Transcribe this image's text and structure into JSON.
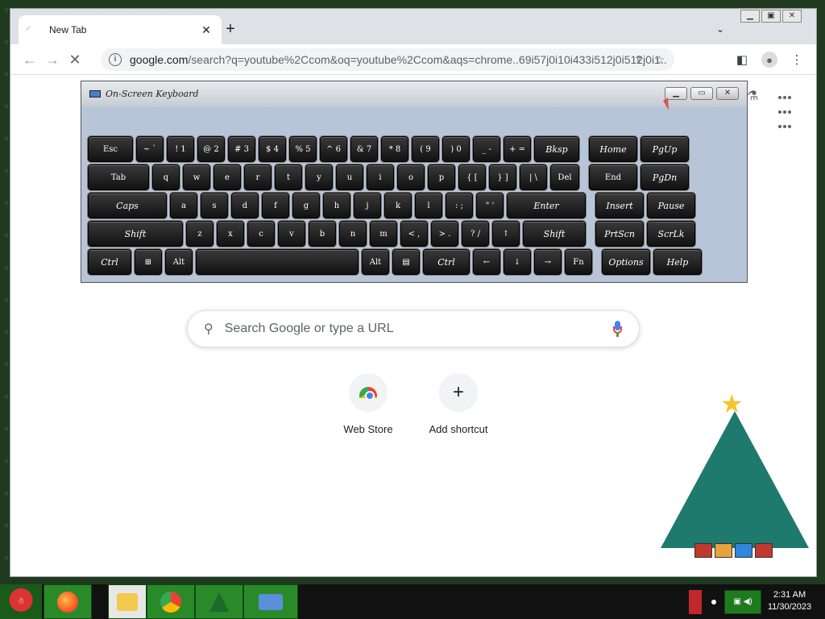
{
  "browser": {
    "tab": {
      "title": "New Tab"
    },
    "address": {
      "host": "google.com",
      "path": "/search?q=youtube%2Ccom&oq=youtube%2Ccom&aqs=chrome..69i57j0i10i433i512j0i512j0i1..."
    }
  },
  "page": {
    "search_placeholder": "Search Google or type a URL",
    "shortcuts": [
      {
        "label": "Web Store"
      },
      {
        "label": "Add shortcut"
      }
    ]
  },
  "osk": {
    "title": "On-Screen Keyboard",
    "rows": [
      [
        {
          "label": "Esc",
          "w": 60
        },
        {
          "label": "~ `",
          "w": 38
        },
        {
          "label": "! 1",
          "w": 38
        },
        {
          "label": "@ 2",
          "w": 38
        },
        {
          "label": "# 3",
          "w": 38
        },
        {
          "label": "$ 4",
          "w": 38
        },
        {
          "label": "% 5",
          "w": 38
        },
        {
          "label": "^ 6",
          "w": 38
        },
        {
          "label": "& 7",
          "w": 38
        },
        {
          "label": "* 8",
          "w": 38
        },
        {
          "label": "( 9",
          "w": 38
        },
        {
          "label": ") 0",
          "w": 38
        },
        {
          "label": "_ -",
          "w": 38
        },
        {
          "label": "+ =",
          "w": 38
        },
        {
          "label": "Bksp",
          "w": 60
        },
        {
          "label": "Home",
          "w": 64,
          "gap": 8
        },
        {
          "label": "PgUp",
          "w": 64
        }
      ],
      [
        {
          "label": "Tab",
          "w": 80
        },
        {
          "label": "q",
          "w": 38
        },
        {
          "label": "w",
          "w": 38
        },
        {
          "label": "e",
          "w": 38
        },
        {
          "label": "r",
          "w": 38
        },
        {
          "label": "t",
          "w": 38
        },
        {
          "label": "y",
          "w": 38
        },
        {
          "label": "u",
          "w": 38
        },
        {
          "label": "i",
          "w": 38
        },
        {
          "label": "o",
          "w": 38
        },
        {
          "label": "p",
          "w": 38
        },
        {
          "label": "{ [",
          "w": 38
        },
        {
          "label": "} ]",
          "w": 38
        },
        {
          "label": "| \\",
          "w": 38
        },
        {
          "label": "Del",
          "w": 40
        },
        {
          "label": "End",
          "w": 64,
          "gap": 8
        },
        {
          "label": "PgDn",
          "w": 64
        }
      ],
      [
        {
          "label": "Caps",
          "w": 102
        },
        {
          "label": "a",
          "w": 38
        },
        {
          "label": "s",
          "w": 38
        },
        {
          "label": "d",
          "w": 38
        },
        {
          "label": "f",
          "w": 38
        },
        {
          "label": "g",
          "w": 38
        },
        {
          "label": "h",
          "w": 38
        },
        {
          "label": "j",
          "w": 38
        },
        {
          "label": "k",
          "w": 38
        },
        {
          "label": "l",
          "w": 38
        },
        {
          "label": ": ;",
          "w": 38
        },
        {
          "label": "\" '",
          "w": 38
        },
        {
          "label": "Enter",
          "w": 102
        },
        {
          "label": "Insert",
          "w": 64,
          "gap": 8
        },
        {
          "label": "Pause",
          "w": 64
        }
      ],
      [
        {
          "label": "Shift",
          "w": 122
        },
        {
          "label": "z",
          "w": 38
        },
        {
          "label": "x",
          "w": 38
        },
        {
          "label": "c",
          "w": 38
        },
        {
          "label": "v",
          "w": 38
        },
        {
          "label": "b",
          "w": 38
        },
        {
          "label": "n",
          "w": 38
        },
        {
          "label": "m",
          "w": 38
        },
        {
          "label": "< ,",
          "w": 38
        },
        {
          "label": "> .",
          "w": 38
        },
        {
          "label": "? /",
          "w": 38
        },
        {
          "label": "↑",
          "w": 38
        },
        {
          "label": "Shift",
          "w": 82
        },
        {
          "label": "PrtScn",
          "w": 64,
          "gap": 8
        },
        {
          "label": "ScrLk",
          "w": 64
        }
      ],
      [
        {
          "label": "Ctrl",
          "w": 58
        },
        {
          "label": "⊞",
          "w": 38
        },
        {
          "label": "Alt",
          "w": 38
        },
        {
          "label": "",
          "w": 206
        },
        {
          "label": "Alt",
          "w": 38
        },
        {
          "label": "▤",
          "w": 38
        },
        {
          "label": "Ctrl",
          "w": 62
        },
        {
          "label": "←",
          "w": 38
        },
        {
          "label": "↓",
          "w": 38
        },
        {
          "label": "→",
          "w": 38
        },
        {
          "label": "Fn",
          "w": 38
        },
        {
          "label": "Options",
          "w": 64,
          "gap": 8
        },
        {
          "label": "Help",
          "w": 64
        }
      ]
    ]
  },
  "taskbar": {
    "apps": [
      "firefox",
      "file-explorer",
      "chrome",
      "tree",
      "on-screen-keyboard"
    ],
    "clock_time": "2:31 AM",
    "clock_date": "11/30/2023"
  }
}
